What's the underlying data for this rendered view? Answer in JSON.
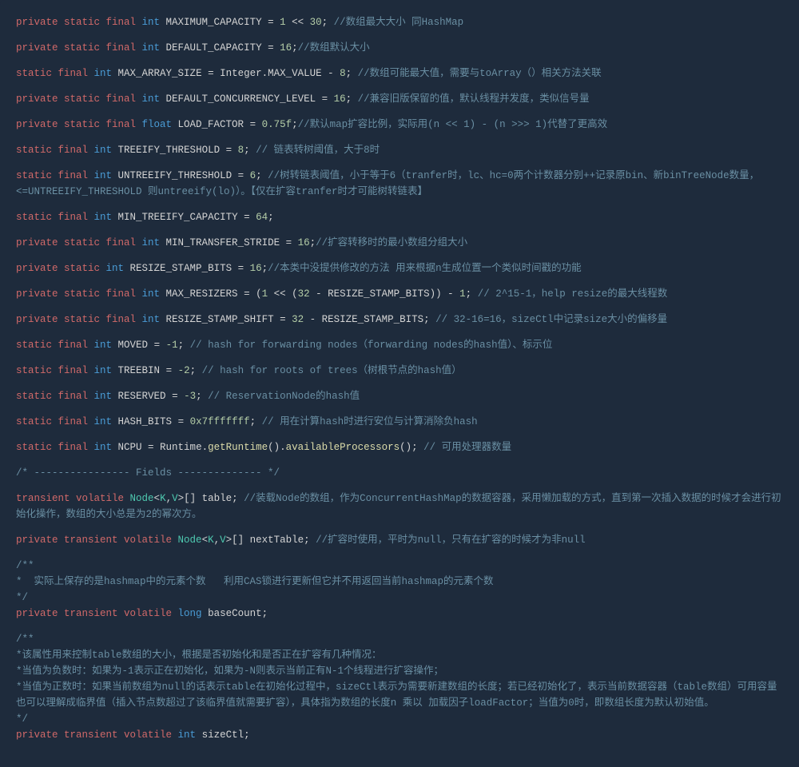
{
  "lines": [
    {
      "type": "stmt",
      "modRed": "private static final ",
      "typeBlue": "int ",
      "name": "MAXIMUM_CAPACITY",
      "op": " = ",
      "val": "1",
      "op2": " << ",
      "val2": "30",
      "end": ";",
      "comment": " //数组最大大小 同HashMap"
    },
    {
      "type": "stmt",
      "modRed": "private static final ",
      "typeBlue": "int ",
      "name": "DEFAULT_CAPACITY",
      "op": " = ",
      "val": "16",
      "end": ";",
      "comment": "//数组默认大小"
    },
    {
      "type": "stmt",
      "modRed": "static final ",
      "typeBlue": "int ",
      "name": "MAX_ARRAY_SIZE",
      "op": " = ",
      "valText": "Integer.MAX_VALUE",
      "op2": " - ",
      "val2": "8",
      "end": "; ",
      "comment": "//数组可能最大值，需要与toArray（）相关方法关联"
    },
    {
      "type": "stmt",
      "modRed": "private static final ",
      "typeBlue": "int ",
      "name": "DEFAULT_CONCURRENCY_LEVEL",
      "op": " = ",
      "val": "16",
      "end": "; ",
      "comment": "//兼容旧版保留的值，默认线程并发度，类似信号量"
    },
    {
      "type": "stmt",
      "modRed": "private static final ",
      "typeBlue": "float ",
      "name": "LOAD_FACTOR",
      "op": " = ",
      "valFloat": "0.75f",
      "end": ";",
      "comment": "//默认map扩容比例，实际用(n << 1) - (n >>> 1)代替了更高效"
    },
    {
      "type": "stmt",
      "modRed": "static final ",
      "typeBlue": "int ",
      "name": "TREEIFY_THRESHOLD",
      "op": " = ",
      "val": "8",
      "end": "; ",
      "comment": "// 链表转树阈值，大于8时"
    },
    {
      "type": "raw",
      "html": "<span class='c-red'>static final </span><span class='c-blue'>int </span><span class='c-white'>UNTREEIFY_THRESHOLD = </span><span class='c-num'>6</span><span class='c-white'>; </span><span class='c-gray'>//树转链表阈值，小于等于6（tranfer时，lc、hc=0两个计数器分别++记录原bin、新binTreeNode数量，&lt;=UNTREEIFY_THRESHOLD 则untreeify(lo)）。【仅在扩容tranfer时才可能树转链表】</span>"
    },
    {
      "type": "stmt",
      "modRed": "static final ",
      "typeBlue": "int ",
      "name": "MIN_TREEIFY_CAPACITY",
      "op": " = ",
      "val": "64",
      "end": ";",
      "comment": ""
    },
    {
      "type": "stmt",
      "modRed": "private static final ",
      "typeBlue": "int ",
      "name": "MIN_TRANSFER_STRIDE",
      "op": " = ",
      "val": "16",
      "end": ";",
      "comment": "//扩容转移时的最小数组分组大小"
    },
    {
      "type": "stmt",
      "modRed": "private static ",
      "typeBlue": "int ",
      "name": "RESIZE_STAMP_BITS",
      "op": " = ",
      "val": "16",
      "end": ";",
      "comment": "//本类中没提供修改的方法 用来根据n生成位置一个类似时间戳的功能"
    },
    {
      "type": "raw",
      "html": "<span class='c-red'>private static final </span><span class='c-blue'>int </span><span class='c-white'>MAX_RESIZERS = (</span><span class='c-num'>1</span><span class='c-white'> &lt;&lt; (</span><span class='c-num'>32</span><span class='c-white'> - RESIZE_STAMP_BITS)) - </span><span class='c-num'>1</span><span class='c-white'>; </span><span class='c-gray'>// 2^15-1，help resize的最大线程数</span>"
    },
    {
      "type": "raw",
      "html": "<span class='c-red'>private static final </span><span class='c-blue'>int </span><span class='c-white'>RESIZE_STAMP_SHIFT = </span><span class='c-num'>32</span><span class='c-white'> - RESIZE_STAMP_BITS; </span><span class='c-gray'>// 32-16=16，sizeCtl中记录size大小的偏移量</span>"
    },
    {
      "type": "stmt",
      "modRed": "static final ",
      "typeBlue": "int ",
      "name": "MOVED",
      "op": " = ",
      "val": "-1",
      "end": "; ",
      "comment": "// hash for forwarding nodes（forwarding nodes的hash值）、标示位"
    },
    {
      "type": "stmt",
      "modRed": "static final ",
      "typeBlue": "int ",
      "name": "TREEBIN",
      "op": " = ",
      "val": "-2",
      "end": "; ",
      "comment": "// hash for roots of trees（树根节点的hash值）"
    },
    {
      "type": "stmt",
      "modRed": "static final ",
      "typeBlue": "int ",
      "name": "RESERVED",
      "op": " = ",
      "val": "-3",
      "end": "; ",
      "comment": "// ReservationNode的hash值"
    },
    {
      "type": "stmt",
      "modRed": "static final ",
      "typeBlue": "int ",
      "name": "HASH_BITS",
      "op": " = ",
      "hex": "0x7fffffff",
      "end": "; ",
      "comment": "// 用在计算hash时进行安位与计算消除负hash"
    },
    {
      "type": "raw",
      "html": "<span class='c-red'>static final </span><span class='c-blue'>int </span><span class='c-white'>NCPU = Runtime.</span><span class='c-yellow'>getRuntime</span><span class='c-white'>().</span><span class='c-yellow'>availableProcessors</span><span class='c-white'>(); </span><span class='c-gray'>// 可用处理器数量</span>"
    },
    {
      "type": "raw",
      "html": "<span class='c-gray'>/* ---------------- Fields -------------- */</span>"
    },
    {
      "type": "raw",
      "html": "<span class='c-red'>transient volatile </span><span class='c-teal'>Node</span><span class='c-white'>&lt;</span><span class='c-teal'>K</span><span class='c-white'>,</span><span class='c-teal'>V</span><span class='c-white'>&gt;[] table; </span><span class='c-gray'>//装载Node的数组，作为ConcurrentHashMap的数据容器，采用懒加载的方式，直到第一次插入数据的时候才会进行初始化操作，数组的大小总是为2的幂次方。</span>"
    },
    {
      "type": "raw",
      "html": "<span class='c-red'>private transient volatile </span><span class='c-teal'>Node</span><span class='c-white'>&lt;</span><span class='c-teal'>K</span><span class='c-white'>,</span><span class='c-teal'>V</span><span class='c-white'>&gt;[] nextTable; </span><span class='c-gray'>//扩容时使用，平时为null，只有在扩容的时候才为非null</span>"
    },
    {
      "type": "raw",
      "html": "<span class='c-gray'>/**\n*  实际上保存的是hashmap中的元素个数   利用CAS锁进行更新但它并不用返回当前hashmap的元素个数\n*/</span>\n<span class='c-red'>private transient volatile </span><span class='c-blue'>long </span><span class='c-white'>baseCount;</span>"
    },
    {
      "type": "raw",
      "html": "<span class='c-gray'>/**\n*该属性用来控制table数组的大小，根据是否初始化和是否正在扩容有几种情况：\n*当值为负数时：如果为-1表示正在初始化，如果为-N则表示当前正有N-1个线程进行扩容操作；\n*当值为正数时：如果当前数组为null的话表示table在初始化过程中，sizeCtl表示为需要新建数组的长度；若已经初始化了，表示当前数据容器（table数组）可用容量也可以理解成临界值（插入节点数超过了该临界值就需要扩容），具体指为数组的长度n 乘以 加载因子loadFactor；当值为0时，即数组长度为默认初始值。\n*/</span>\n<span class='c-red'>private transient volatile </span><span class='c-blue'>int </span><span class='c-white'>sizeCtl;</span>"
    }
  ]
}
